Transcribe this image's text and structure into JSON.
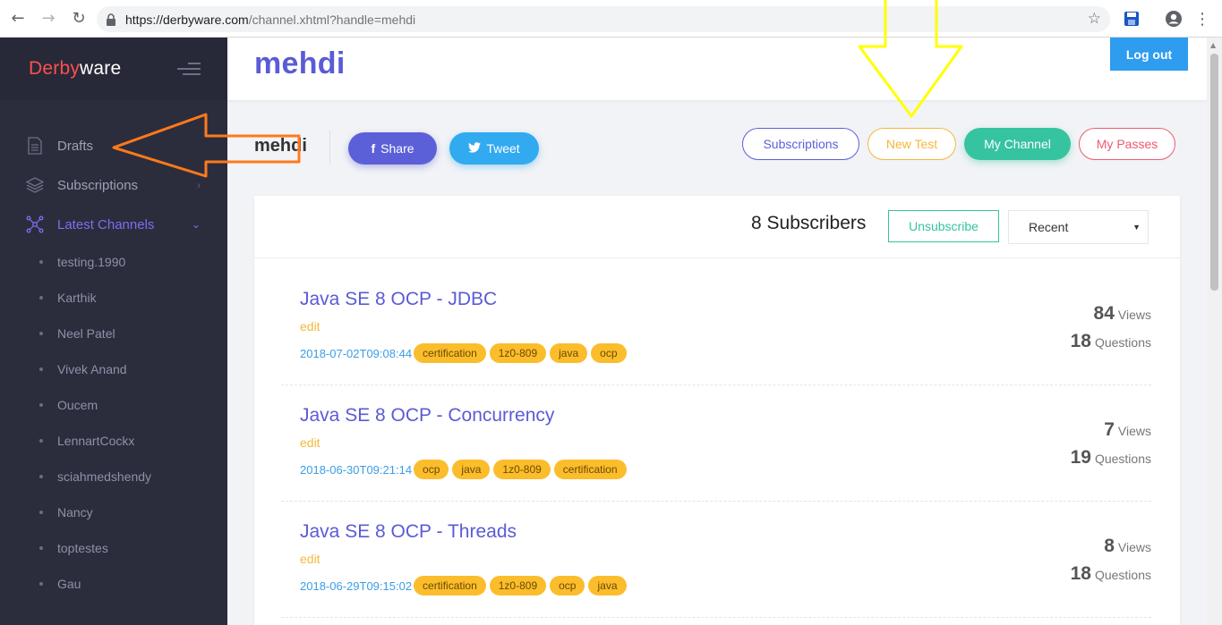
{
  "browser": {
    "url_host": "https://derbyware.com",
    "url_path": "/channel.xhtml?handle=mehdi"
  },
  "sidebar": {
    "logo_part1": "Derby",
    "logo_part2": "ware",
    "items": [
      {
        "label": "Drafts",
        "icon": "document-icon"
      },
      {
        "label": "Subscriptions",
        "icon": "layers-icon"
      },
      {
        "label": "Latest Channels",
        "icon": "network-icon"
      }
    ],
    "channels": [
      "testing.1990",
      "Karthik",
      "Neel Patel",
      "Vivek Anand",
      "Oucem",
      "LennartCockx",
      "sciahmedshendy",
      "Nancy",
      "toptestes",
      "Gau"
    ]
  },
  "header": {
    "title": "mehdi",
    "logout_label": "Log out"
  },
  "channel_bar": {
    "name": "mehdi",
    "share_label": "Share",
    "tweet_label": "Tweet",
    "subscriptions_label": "Subscriptions",
    "new_test_label": "New Test",
    "my_channel_label": "My Channel",
    "my_passes_label": "My Passes"
  },
  "card": {
    "subscribers": "8 Subscribers",
    "unsubscribe_label": "Unsubscribe",
    "sort_selected": "Recent",
    "views_label": "Views",
    "questions_label": "Questions",
    "edit_label": "edit",
    "tests": [
      {
        "title": "Java SE 8 OCP - JDBC",
        "date": "2018-07-02T09:08:44",
        "tags": [
          "certification",
          "1z0-809",
          "java",
          "ocp"
        ],
        "views": "84",
        "questions": "18"
      },
      {
        "title": "Java SE 8 OCP - Concurrency",
        "date": "2018-06-30T09:21:14",
        "tags": [
          "ocp",
          "java",
          "1z0-809",
          "certification"
        ],
        "views": "7",
        "questions": "19"
      },
      {
        "title": "Java SE 8 OCP - Threads",
        "date": "2018-06-29T09:15:02",
        "tags": [
          "certification",
          "1z0-809",
          "ocp",
          "java"
        ],
        "views": "8",
        "questions": "18"
      }
    ]
  },
  "colors": {
    "sidebar_bg": "#2b2d3d",
    "accent_purple": "#5a5bd6",
    "accent_green": "#36c3a0",
    "accent_yellow": "#f6b73c",
    "accent_red": "#ef5b6e",
    "tag_bg": "#fbbd2b",
    "annotation_orange": "#ff7a1a",
    "annotation_yellow": "#ffff00"
  }
}
